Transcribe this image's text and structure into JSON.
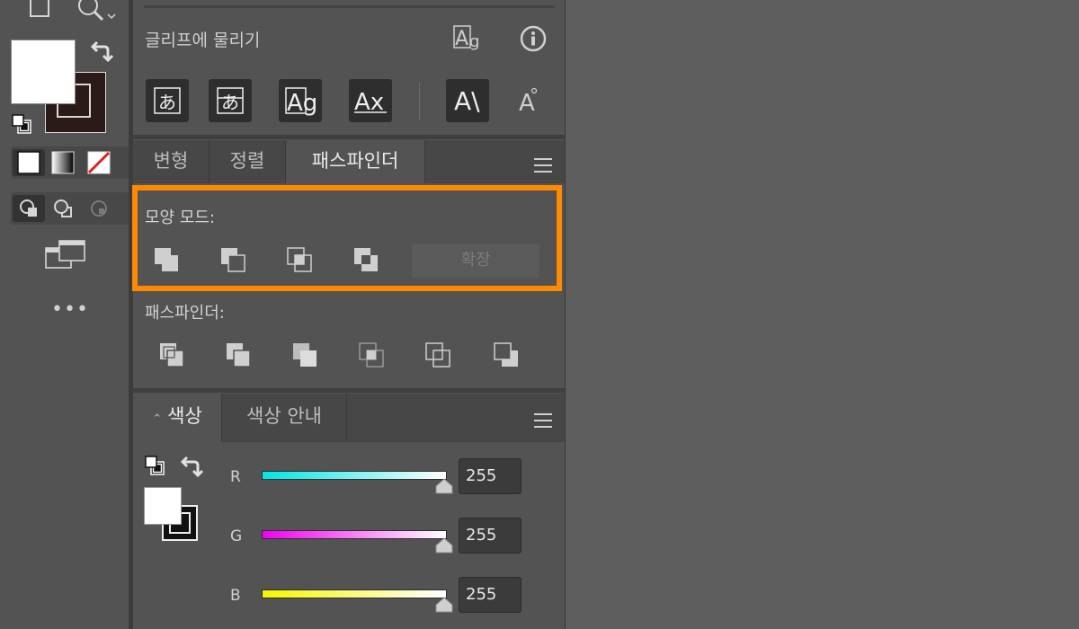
{
  "toolbar": {
    "more_label": "•••"
  },
  "glyph_panel": {
    "title": "글리프에 물리기",
    "buttons": [
      "あ",
      "あ",
      "Ag",
      "Ax",
      "A\\",
      "A"
    ]
  },
  "tabs": [
    {
      "label": "변형"
    },
    {
      "label": "정렬"
    },
    {
      "label": "패스파인더"
    }
  ],
  "pathfinder": {
    "shape_modes_label": "모양 모드:",
    "expand_label": "확장",
    "pathfinders_label": "패스파인더:"
  },
  "color_tabs": [
    {
      "label": "색상"
    },
    {
      "label": "색상 안내"
    }
  ],
  "color": {
    "channels": [
      {
        "name": "R",
        "value": "255",
        "gradient_end": "#00ffff"
      },
      {
        "name": "G",
        "value": "255",
        "gradient_end": "#ff00ff"
      },
      {
        "name": "B",
        "value": "255",
        "gradient_end": "#ffff00"
      }
    ]
  },
  "colors": {
    "accent_highlight": "#ff8a00",
    "panel_bg": "#535353",
    "canvas_bg": "#5e5e5e"
  }
}
